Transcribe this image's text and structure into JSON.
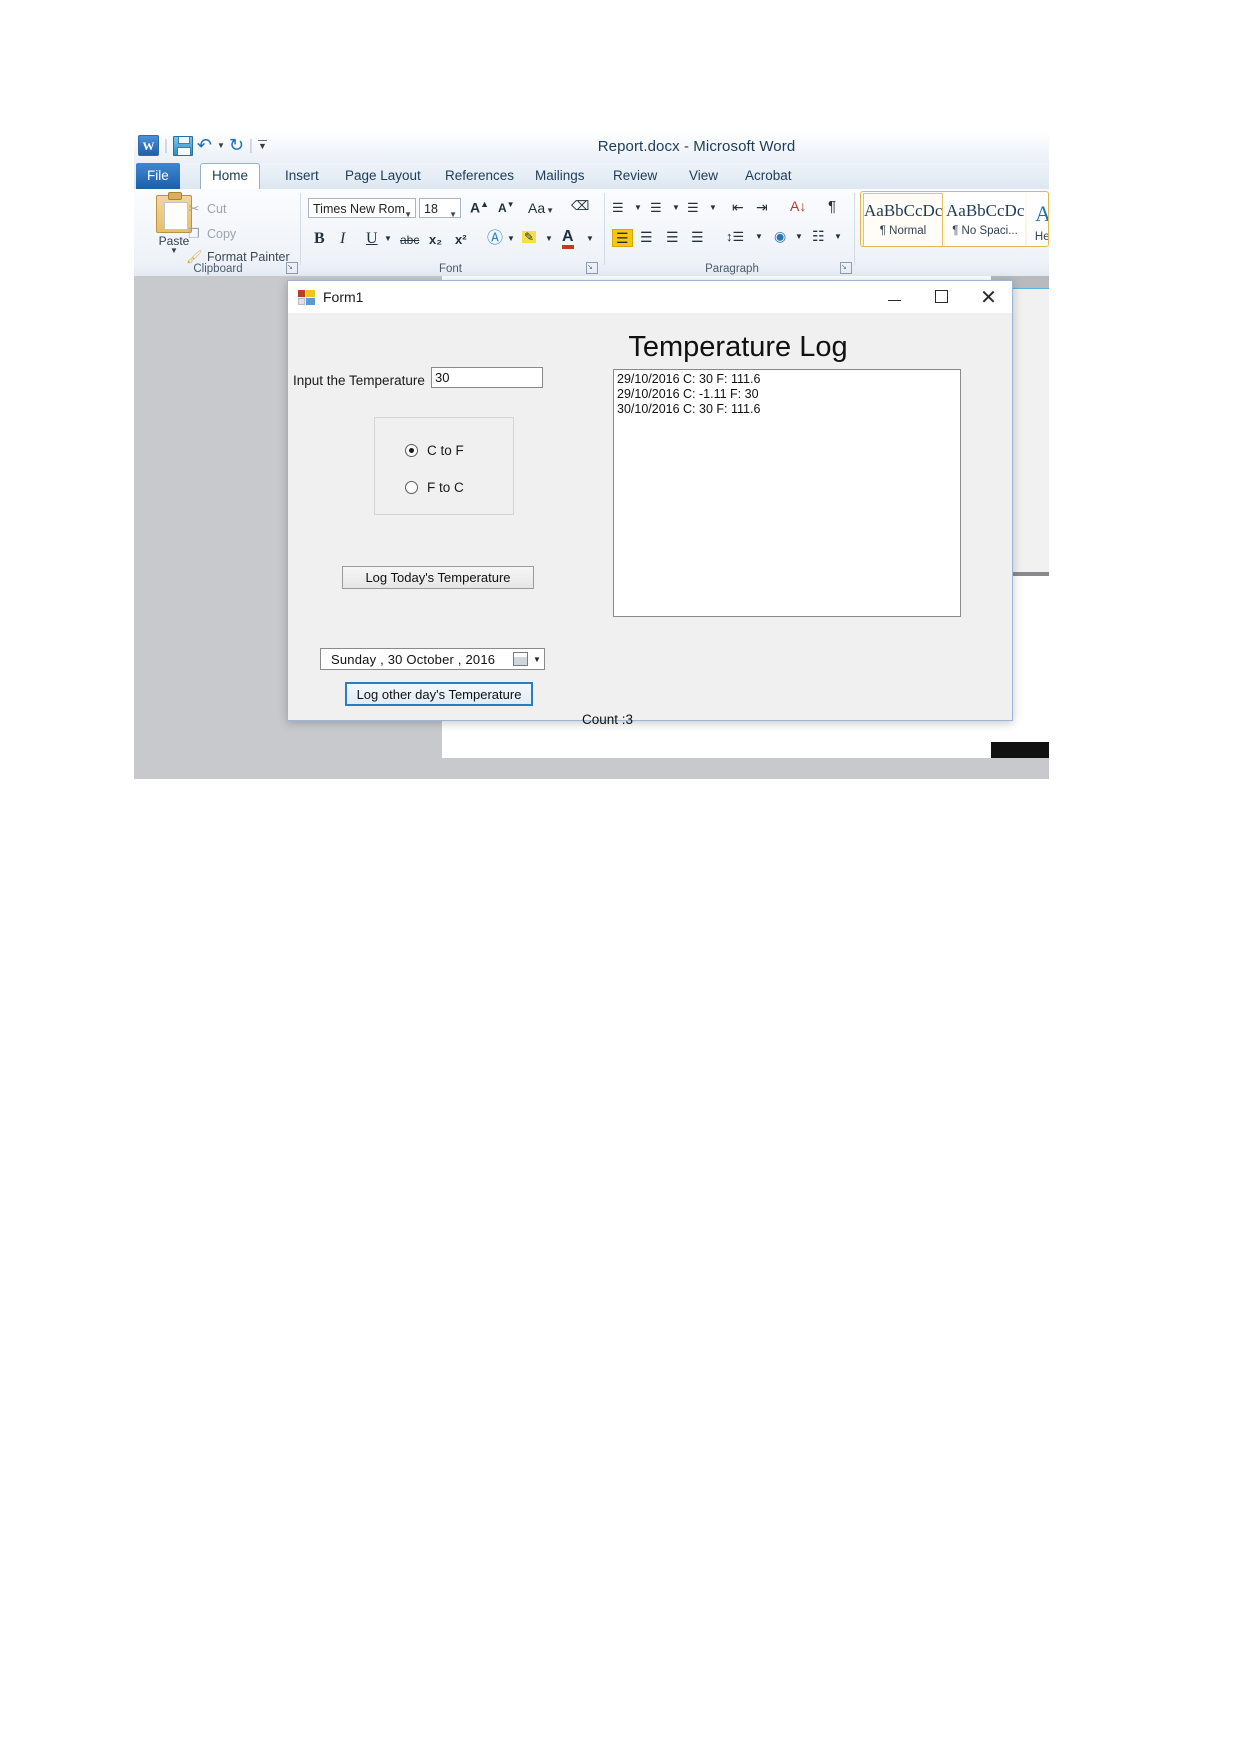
{
  "word": {
    "title": "Report.docx  -  Microsoft Word",
    "quick_access": {
      "app_icon": "word-icon",
      "save": "save-icon",
      "undo": "undo-icon",
      "redo": "redo-icon",
      "customize": "customize-quick-access-icon"
    },
    "tabs": [
      {
        "label": "File",
        "state": "file"
      },
      {
        "label": "Home",
        "state": "active"
      },
      {
        "label": "Insert",
        "state": "normal"
      },
      {
        "label": "Page Layout",
        "state": "normal"
      },
      {
        "label": "References",
        "state": "normal"
      },
      {
        "label": "Mailings",
        "state": "normal"
      },
      {
        "label": "Review",
        "state": "normal"
      },
      {
        "label": "View",
        "state": "normal"
      },
      {
        "label": "Acrobat",
        "state": "normal"
      }
    ],
    "clipboard": {
      "group_label": "Clipboard",
      "paste": "Paste",
      "cut": "Cut",
      "copy": "Copy",
      "format_painter": "Format Painter"
    },
    "font": {
      "group_label": "Font",
      "font_name": "Times New Rom",
      "font_size": "18",
      "grow_font": "A",
      "shrink_font": "A",
      "change_case": "Aa",
      "clear_formatting": "clear-formatting-icon",
      "bold": "B",
      "italic": "I",
      "underline": "U",
      "strikethrough": "abc",
      "subscript": "x₂",
      "superscript": "x²",
      "text_effects": "A",
      "highlight": "ab",
      "font_color": "A"
    },
    "paragraph": {
      "group_label": "Paragraph",
      "bullets": "bullets-icon",
      "numbering": "numbering-icon",
      "multilevel": "multilevel-list-icon",
      "decrease_indent": "decrease-indent-icon",
      "increase_indent": "increase-indent-icon",
      "sort": "sort-icon",
      "show_marks": "¶",
      "align_left": "align-left-icon",
      "align_center": "align-center-icon",
      "align_right": "align-right-icon",
      "justify": "justify-icon",
      "line_spacing": "line-spacing-icon",
      "shading": "shading-icon",
      "borders": "borders-icon"
    },
    "styles": [
      {
        "sample": "AaBbCcDc",
        "name": "¶ Normal",
        "selected": true
      },
      {
        "sample": "AaBbCcDc",
        "name": "¶ No Spaci...",
        "selected": false
      },
      {
        "sample": "Aa",
        "name": "He…",
        "selected": false
      }
    ]
  },
  "form": {
    "title": "Form1",
    "icon": "winforms-icon",
    "window_buttons": {
      "minimize": "minimize-icon",
      "maximize": "maximize-icon",
      "close": "close-icon"
    },
    "heading": "Temperature Log",
    "input_label": "Input the Temperature",
    "input_value": "30",
    "conversion_options": [
      {
        "label": "C to F",
        "selected": true
      },
      {
        "label": "F to C",
        "selected": false
      }
    ],
    "log_today_button": "Log Today's Temperature",
    "date_value": "Sunday    , 30  October   , 2016",
    "date_calendar_icon": "calendar-icon",
    "date_dropdown_icon": "chevron-down-icon",
    "log_other_button": "Log other day's Temperature",
    "count_label": "Count :3",
    "log_entries": [
      "29/10/2016 C: 30 F: 111.6",
      "29/10/2016 C: -1.11 F: 30",
      "30/10/2016 C: 30 F: 111.6"
    ]
  }
}
